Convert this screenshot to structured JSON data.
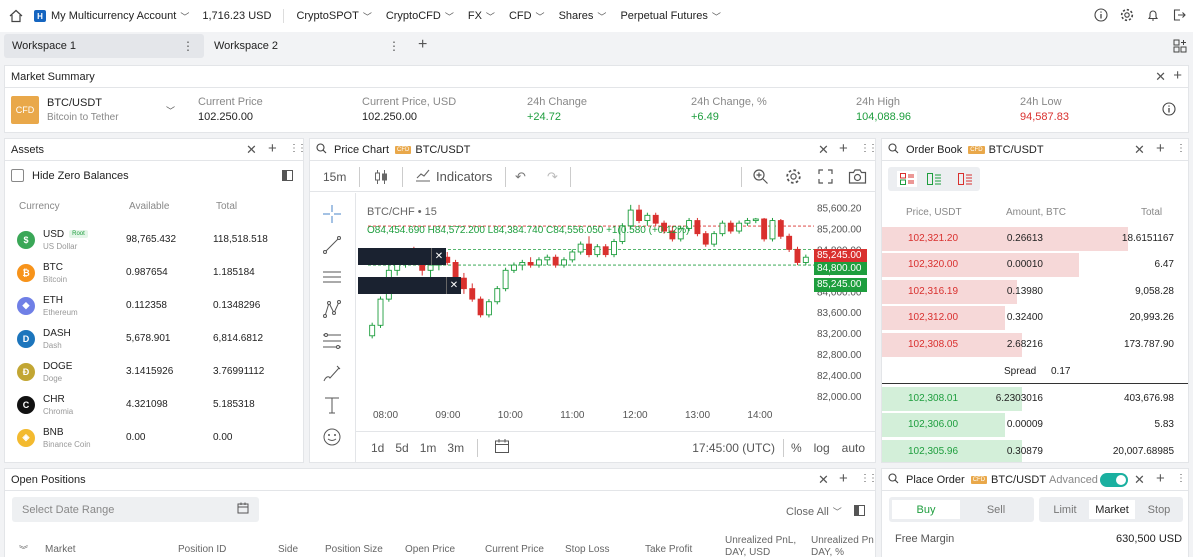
{
  "nav": {
    "account": "My Multicurrency Account",
    "balance": "1,716.23 USD",
    "menus": [
      "CryptoSPOT",
      "CryptoCFD",
      "FX",
      "CFD",
      "Shares",
      "Perpetual Futures"
    ]
  },
  "workspaces": {
    "tab1": "Workspace 1",
    "tab2": "Workspace 2"
  },
  "market_summary": {
    "title": "Market Summary",
    "badge": "CFD",
    "symbol": "BTC/USDT",
    "name": "Bitcoin to Tether",
    "cols": [
      {
        "label": "Current Price",
        "value": "102.250.00",
        "tone": "plain"
      },
      {
        "label": "Current Price, USD",
        "value": "102.250.00",
        "tone": "plain"
      },
      {
        "label": "24h Change",
        "value": "+24.72",
        "tone": "green"
      },
      {
        "label": "24h Change, %",
        "value": "+6.49",
        "tone": "green"
      },
      {
        "label": "24h High",
        "value": "104,088.96",
        "tone": "green"
      },
      {
        "label": "24h Low",
        "value": "94,587.83",
        "tone": "red"
      }
    ]
  },
  "assets": {
    "title": "Assets",
    "hide_zero": "Hide Zero Balances",
    "headers": [
      "Currency",
      "Available",
      "Total"
    ],
    "rows": [
      {
        "code": "USD",
        "tag": "Root",
        "name": "US Dollar",
        "available": "98,765.432",
        "total": "118,518.518",
        "icon": "dollar-icon",
        "color": "#3aa757",
        "glyph": "$"
      },
      {
        "code": "BTC",
        "tag": "",
        "name": "Bitcoin",
        "available": "0.987654",
        "total": "1.185184",
        "icon": "bitcoin-icon",
        "color": "#f7931a",
        "glyph": "₿"
      },
      {
        "code": "ETH",
        "tag": "",
        "name": "Ethereum",
        "available": "0.112358",
        "total": "0.1348296",
        "icon": "ethereum-icon",
        "color": "#6f7fe6",
        "glyph": "◆"
      },
      {
        "code": "DASH",
        "tag": "",
        "name": "Dash",
        "available": "5,678.901",
        "total": "6,814.6812",
        "icon": "dash-icon",
        "color": "#1c75bc",
        "glyph": "D"
      },
      {
        "code": "DOGE",
        "tag": "",
        "name": "Doge",
        "available": "3.1415926",
        "total": "3.76991112",
        "icon": "doge-icon",
        "color": "#c2a633",
        "glyph": "Ð"
      },
      {
        "code": "CHR",
        "tag": "",
        "name": "Chromia",
        "available": "4.321098",
        "total": "5.185318",
        "icon": "chromia-icon",
        "color": "#111111",
        "glyph": "C"
      },
      {
        "code": "BNB",
        "tag": "",
        "name": "Binance Coin",
        "available": "0.00",
        "total": "0.00",
        "icon": "bnb-icon",
        "color": "#f3ba2f",
        "glyph": "◈"
      }
    ]
  },
  "price_chart": {
    "title": "Price Chart",
    "badge": "CFD",
    "symbol": "BTC/USDT",
    "interval": "15m",
    "indicators": "Indicators",
    "legend_title": "BTC/CHF • 15",
    "ohlc": "O84,454.690 H84,572.200 L84,384.740 C84,556.050 +1(0.580 (+0.12%)",
    "price_ticks": [
      "85,600.20",
      "85,200.00",
      "84,800.00",
      "84,400.00",
      "84,000.00",
      "83,600.00",
      "83,200.00",
      "82,800.00",
      "82,400.00",
      "82,000.00"
    ],
    "time_ticks": [
      "08:00",
      "09:00",
      "10:00",
      "11:00",
      "12:00",
      "13:00",
      "14:00"
    ],
    "tag_red": "85,245.00",
    "tag_green_mid": "84,800.00",
    "tag_green_low": "85,245.00",
    "ranges": [
      "1d",
      "5d",
      "1m",
      "3m"
    ],
    "clock": "17:45:00 (UTC)",
    "pct": "%",
    "log": "log",
    "auto": "auto"
  },
  "chart_data": {
    "type": "candlestick",
    "title": "BTC/CHF • 15",
    "xlabel": "",
    "ylabel": "",
    "x_ticks": [
      "08:00",
      "09:00",
      "10:00",
      "11:00",
      "12:00",
      "13:00",
      "14:00"
    ],
    "ylim": [
      82000,
      85800
    ],
    "y_ticks": [
      85600.2,
      85200,
      84800,
      84400,
      84000,
      83600,
      83200,
      82800,
      82400,
      82000
    ],
    "candles": [
      [
        83150,
        83400,
        83100,
        83350
      ],
      [
        83350,
        83900,
        83300,
        83850
      ],
      [
        83850,
        84500,
        83800,
        84400
      ],
      [
        84400,
        84650,
        84300,
        84550
      ],
      [
        84550,
        84750,
        84450,
        84650
      ],
      [
        84650,
        84850,
        84500,
        84550
      ],
      [
        84550,
        84650,
        84300,
        84400
      ],
      [
        84400,
        84550,
        84200,
        84500
      ],
      [
        84500,
        84700,
        84400,
        84650
      ],
      [
        84650,
        84750,
        84500,
        84550
      ],
      [
        84550,
        84600,
        84200,
        84250
      ],
      [
        84250,
        84350,
        83950,
        84050
      ],
      [
        84050,
        84150,
        83800,
        83850
      ],
      [
        83850,
        83900,
        83500,
        83550
      ],
      [
        83550,
        83850,
        83500,
        83800
      ],
      [
        83800,
        84100,
        83750,
        84050
      ],
      [
        84050,
        84450,
        84000,
        84400
      ],
      [
        84400,
        84550,
        84350,
        84500
      ],
      [
        84500,
        84600,
        84400,
        84550
      ],
      [
        84550,
        84650,
        84450,
        84500
      ],
      [
        84500,
        84650,
        84450,
        84600
      ],
      [
        84600,
        84700,
        84500,
        84650
      ],
      [
        84650,
        84700,
        84450,
        84500
      ],
      [
        84500,
        84650,
        84450,
        84600
      ],
      [
        84600,
        84800,
        84550,
        84750
      ],
      [
        84750,
        84950,
        84700,
        84900
      ],
      [
        84900,
        85050,
        84650,
        84700
      ],
      [
        84700,
        84900,
        84650,
        84850
      ],
      [
        84850,
        84900,
        84650,
        84700
      ],
      [
        84700,
        85000,
        84650,
        84950
      ],
      [
        84950,
        85300,
        84900,
        85250
      ],
      [
        85250,
        85650,
        85200,
        85550
      ],
      [
        85550,
        85650,
        85300,
        85350
      ],
      [
        85350,
        85500,
        85250,
        85450
      ],
      [
        85450,
        85500,
        85250,
        85300
      ],
      [
        85300,
        85350,
        85100,
        85150
      ],
      [
        85150,
        85250,
        84950,
        85000
      ],
      [
        85000,
        85250,
        84950,
        85200
      ],
      [
        85200,
        85400,
        85150,
        85350
      ],
      [
        85350,
        85400,
        85050,
        85100
      ],
      [
        85100,
        85150,
        84850,
        84900
      ],
      [
        84900,
        85150,
        84850,
        85100
      ],
      [
        85100,
        85350,
        85050,
        85300
      ],
      [
        85300,
        85350,
        85100,
        85150
      ],
      [
        85150,
        85350,
        85100,
        85300
      ],
      [
        85300,
        85400,
        85250,
        85350
      ],
      [
        85350,
        85400,
        85300,
        85380
      ],
      [
        85380,
        85400,
        84950,
        85000
      ],
      [
        85000,
        85400,
        84950,
        85350
      ],
      [
        85350,
        85380,
        85000,
        85050
      ],
      [
        85050,
        85100,
        84750,
        84800
      ],
      [
        84800,
        84850,
        84500,
        84550
      ],
      [
        84550,
        84700,
        84500,
        84650
      ]
    ],
    "price_lines": [
      {
        "value": 85245,
        "label": "85,245.00",
        "color": "#d9302e"
      },
      {
        "value": 84800,
        "label": "84,800.00",
        "color": "#1e9e3e"
      }
    ]
  },
  "order_book": {
    "title": "Order Book",
    "badge": "CFD",
    "symbol": "BTC/USDT",
    "headers": [
      "Price, USDT",
      "Amount, BTC",
      "Total"
    ],
    "asks": [
      {
        "price": "102,321.20",
        "amount": "0.26613",
        "total": "18.6151167",
        "depth": 1.0
      },
      {
        "price": "102,320.00",
        "amount": "0.00010",
        "total": "6.47",
        "depth": 0.8
      },
      {
        "price": "102,316.19",
        "amount": "0.13980",
        "total": "9,058.28",
        "depth": 0.55
      },
      {
        "price": "102,312.00",
        "amount": "0.32400",
        "total": "20,993.26",
        "depth": 0.5
      },
      {
        "price": "102,308.05",
        "amount": "2.68216",
        "total": "173.787.90",
        "depth": 0.57
      }
    ],
    "spread_label": "Spread",
    "spread_value": "0.17",
    "bids": [
      {
        "price": "102,308.01",
        "amount": "6.2303016",
        "total": "403,676.98",
        "depth": 0.57
      },
      {
        "price": "102,306.00",
        "amount": "0.00009",
        "total": "5.83",
        "depth": 0.5
      },
      {
        "price": "102,305.96",
        "amount": "0.30879",
        "total": "20,007.68985",
        "depth": 0.57
      }
    ]
  },
  "open_positions": {
    "title": "Open Positions",
    "date_placeholder": "Select Date Range",
    "close_all": "Close All",
    "headers": [
      "Market",
      "Position ID",
      "Side",
      "Position Size",
      "Open Price",
      "Current Price",
      "Stop Loss",
      "Take Profit",
      "Unrealized PnL, DAY, USD",
      "Unrealized Pn DAY, %"
    ]
  },
  "place_order": {
    "title": "Place Order",
    "badge": "CFD",
    "symbol": "BTC/USDT",
    "advanced": "Advanced",
    "buy": "Buy",
    "sell": "Sell",
    "limit": "Limit",
    "market": "Market",
    "stop": "Stop",
    "free_margin_label": "Free Margin",
    "free_margin_value": "630,500 USD"
  }
}
